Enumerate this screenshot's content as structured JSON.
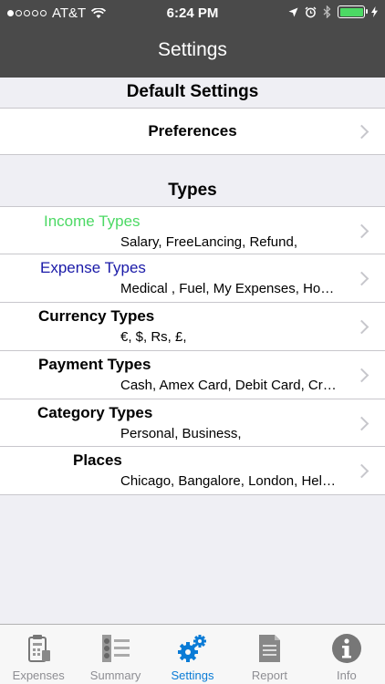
{
  "status_bar": {
    "carrier": "AT&T",
    "time": "6:24 PM"
  },
  "nav": {
    "title": "Settings"
  },
  "sections": {
    "default": {
      "header": "Default Settings",
      "preferences_label": "Preferences"
    },
    "types": {
      "header": "Types",
      "items": [
        {
          "label": "Income Types",
          "detail": "Salary, FreeLancing, Refund,",
          "color": "#4cd964"
        },
        {
          "label": "Expense Types",
          "detail": "Medical , Fuel, My Expenses, Ho…",
          "color": "#1a1aa8"
        },
        {
          "label": "Currency Types",
          "detail": "€, $, Rs, £,",
          "color": "#000000"
        },
        {
          "label": "Payment Types",
          "detail": "Cash, Amex Card, Debit Card, Cr…",
          "color": "#000000"
        },
        {
          "label": "Category Types",
          "detail": "Personal, Business,",
          "color": "#000000"
        },
        {
          "label": "Places",
          "detail": "Chicago, Bangalore, London, Hel…",
          "color": "#000000"
        }
      ]
    }
  },
  "tab_bar": {
    "tabs": [
      {
        "label": "Expenses",
        "icon": "expenses-icon"
      },
      {
        "label": "Summary",
        "icon": "summary-icon"
      },
      {
        "label": "Settings",
        "icon": "settings-gears-icon",
        "active": true
      },
      {
        "label": "Report",
        "icon": "report-icon"
      },
      {
        "label": "Info",
        "icon": "info-icon"
      }
    ],
    "active_color": "#0a7bd6"
  }
}
